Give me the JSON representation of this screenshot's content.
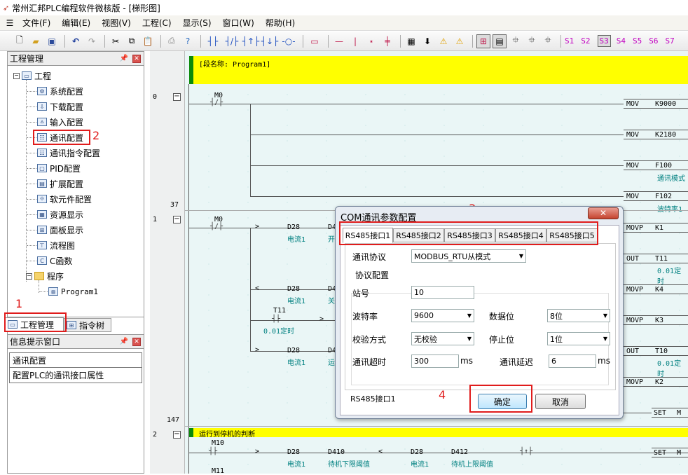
{
  "window": {
    "title": "常州汇邦PLC编程软件微核版 - [梯形图]"
  },
  "menu": [
    "文件(F)",
    "编辑(E)",
    "视图(V)",
    "工程(C)",
    "显示(S)",
    "窗口(W)",
    "帮助(H)"
  ],
  "toolbar": {
    "icons": [
      "new-file-icon",
      "open-folder-icon",
      "save-icon",
      "undo-icon",
      "redo-icon",
      "cut-icon",
      "copy-icon",
      "paste-icon",
      "print-icon",
      "help-icon"
    ],
    "ladder_symbols": [
      "┤├",
      "┤/├",
      "┤↑├",
      "┤↓├",
      "-○-",
      "▭",
      "—",
      "|",
      "⋆",
      "╪"
    ],
    "s_buttons": [
      "S1",
      "S2",
      "S3",
      "S4",
      "S5",
      "S6",
      "S7"
    ],
    "s_pressed": "S3"
  },
  "project_panel": {
    "title": "工程管理",
    "root": "工程",
    "items": [
      "系统配置",
      "下载配置",
      "输入配置",
      "通讯配置",
      "通讯指令配置",
      "PID配置",
      "扩展配置",
      "软元件配置",
      "资源显示",
      "面板显示",
      "流程图",
      "C函数"
    ],
    "program_folder": "程序",
    "program": "Program1",
    "tabs": [
      "工程管理",
      "指令树"
    ]
  },
  "info_panel": {
    "title": "信息提示窗口",
    "lines": [
      "通讯配置",
      "配置PLC的通讯接口属性"
    ]
  },
  "annotations": [
    "1",
    "2",
    "3",
    "4"
  ],
  "ladder": {
    "segment_name": "[段名称: Program1]",
    "row_numbers": [
      "0",
      "37",
      "1",
      "147",
      "2"
    ],
    "contacts": {
      "m0": "M0",
      "t11": "T11",
      "m10": "M10",
      "m11": "M11"
    },
    "compare": {
      "d28": "D28",
      "d4": "D4",
      "d410": "D410",
      "d412": "D412"
    },
    "labels": {
      "current": "电流1",
      "open": "开",
      "close": "关",
      "run": "运",
      "t11_time": "0.01定时",
      "t11_time2": "0.01定时",
      "t10_time": "0.01定时",
      "standby_low": "待机下限阈值",
      "standby_high": "待机上限阈值",
      "comm_mode": "通讯模式",
      "baud": "波特率1",
      "stop_section": "运行到停机的判断"
    },
    "right_cmds": [
      {
        "op": "MOV",
        "arg": "K9000"
      },
      {
        "op": "MOV",
        "arg": "K2180"
      },
      {
        "op": "MOV",
        "arg": "F100"
      },
      {
        "op": "MOV",
        "arg": "F102"
      },
      {
        "op": "MOVP",
        "arg": "K1"
      },
      {
        "op": "OUT",
        "arg": "T11"
      },
      {
        "op": "MOVP",
        "arg": "K4"
      },
      {
        "op": "MOVP",
        "arg": "K3"
      },
      {
        "op": "OUT",
        "arg": "T10"
      },
      {
        "op": "MOVP",
        "arg": "K2"
      },
      {
        "op": "SET",
        "arg": "M"
      },
      {
        "op": "SET",
        "arg": "M"
      }
    ]
  },
  "dialog": {
    "title": "COM通讯参数配置",
    "close": "✕",
    "tabs": [
      "RS485接口1",
      "RS485接口2",
      "RS485接口3",
      "RS485接口4",
      "RS485接口5"
    ],
    "protocol_label": "通讯协议",
    "protocol_value": "MODBUS_RTU从模式",
    "group_label": "协议配置",
    "station_label": "站号",
    "station_value": "10",
    "baud_label": "波特率",
    "baud_value": "9600",
    "databits_label": "数据位",
    "databits_value": "8位",
    "parity_label": "校验方式",
    "parity_value": "无校验",
    "stopbits_label": "停止位",
    "stopbits_value": "1位",
    "timeout_label": "通讯超时",
    "timeout_value": "300",
    "timeout_unit": "ms",
    "delay_label": "通讯延迟",
    "delay_value": "6",
    "delay_unit": "ms",
    "status": "RS485接口1",
    "ok": "确定",
    "cancel": "取消"
  }
}
